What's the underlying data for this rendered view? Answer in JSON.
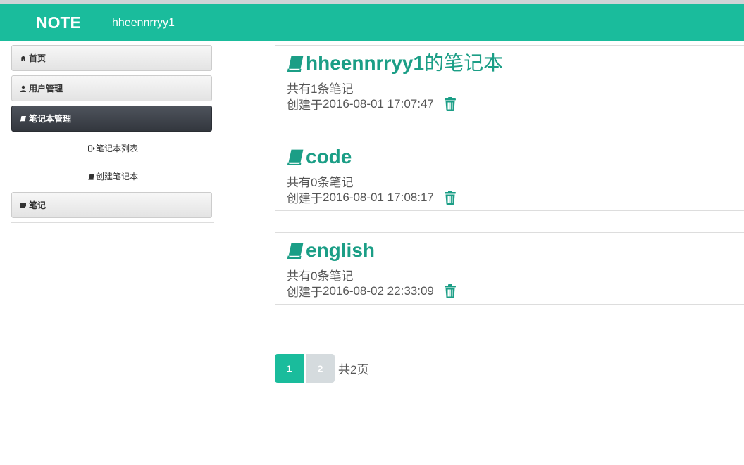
{
  "navbar": {
    "brand": "NOTE",
    "user": "hheennrryy1",
    "color": "#1abc9c"
  },
  "sidebar": {
    "items": [
      {
        "label": "首页",
        "icon": "home-icon"
      },
      {
        "label": "用户管理",
        "icon": "user-icon"
      },
      {
        "label": "笔记本管理",
        "icon": "book-icon",
        "active": true
      },
      {
        "label": "笔记",
        "icon": "sticky-note-icon"
      }
    ],
    "subitems": [
      {
        "label": "笔记本列表",
        "icon": "sign-out-icon"
      },
      {
        "label": "创建笔记本",
        "icon": "book-icon"
      }
    ]
  },
  "notebooks": [
    {
      "name": "hheennrryy1",
      "suffix": "的笔记本",
      "count_prefix": "共有",
      "count": "1",
      "count_suffix": "条笔记",
      "created_prefix": "创建于",
      "created": "2016-08-01 17:07:47"
    },
    {
      "name": "code",
      "suffix": "",
      "count_prefix": "共有",
      "count": "0",
      "count_suffix": "条笔记",
      "created_prefix": "创建于",
      "created": "2016-08-01 17:08:17"
    },
    {
      "name": "english",
      "suffix": "",
      "count_prefix": "共有",
      "count": "0",
      "count_suffix": "条笔记",
      "created_prefix": "创建于",
      "created": "2016-08-02 22:33:09"
    }
  ],
  "pagination": {
    "pages": [
      "1",
      "2"
    ],
    "current": "1",
    "total_prefix": "共",
    "total": "2",
    "total_suffix": "页"
  }
}
